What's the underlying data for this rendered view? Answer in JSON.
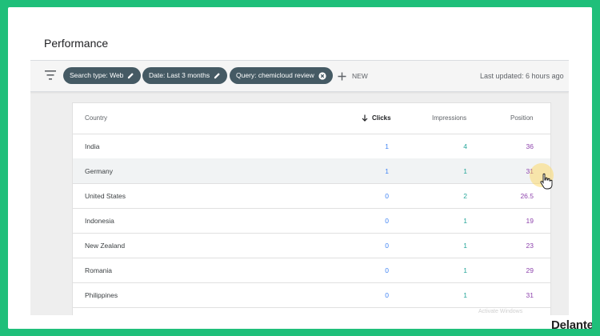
{
  "header": {
    "title": "Performance"
  },
  "filters": {
    "chips": [
      {
        "label": "Search type: Web",
        "icon": "edit-icon"
      },
      {
        "label": "Date: Last 3 months",
        "icon": "edit-icon"
      },
      {
        "label": "Query: chemicloud review",
        "icon": "close-circle-icon"
      }
    ],
    "new_label": "NEW",
    "last_updated": "Last updated: 6 hours ago"
  },
  "table": {
    "columns": [
      "Country",
      "Clicks",
      "Impressions",
      "Position"
    ],
    "sorted_column": "Clicks",
    "rows": [
      {
        "country": "India",
        "clicks": "1",
        "impressions": "4",
        "position": "36"
      },
      {
        "country": "Germany",
        "clicks": "1",
        "impressions": "1",
        "position": "31"
      },
      {
        "country": "United States",
        "clicks": "0",
        "impressions": "2",
        "position": "26.5"
      },
      {
        "country": "Indonesia",
        "clicks": "0",
        "impressions": "1",
        "position": "19"
      },
      {
        "country": "New Zealand",
        "clicks": "0",
        "impressions": "1",
        "position": "23"
      },
      {
        "country": "Romania",
        "clicks": "0",
        "impressions": "1",
        "position": "29"
      },
      {
        "country": "Philippines",
        "clicks": "0",
        "impressions": "1",
        "position": "31"
      }
    ]
  },
  "colors": {
    "border": "#1fbf7a",
    "chip": "#455a64",
    "clicks": "#4285f4",
    "impressions": "#26a69a",
    "position": "#8e44ad"
  },
  "watermark": "Activate Windows",
  "brand": "Delante"
}
